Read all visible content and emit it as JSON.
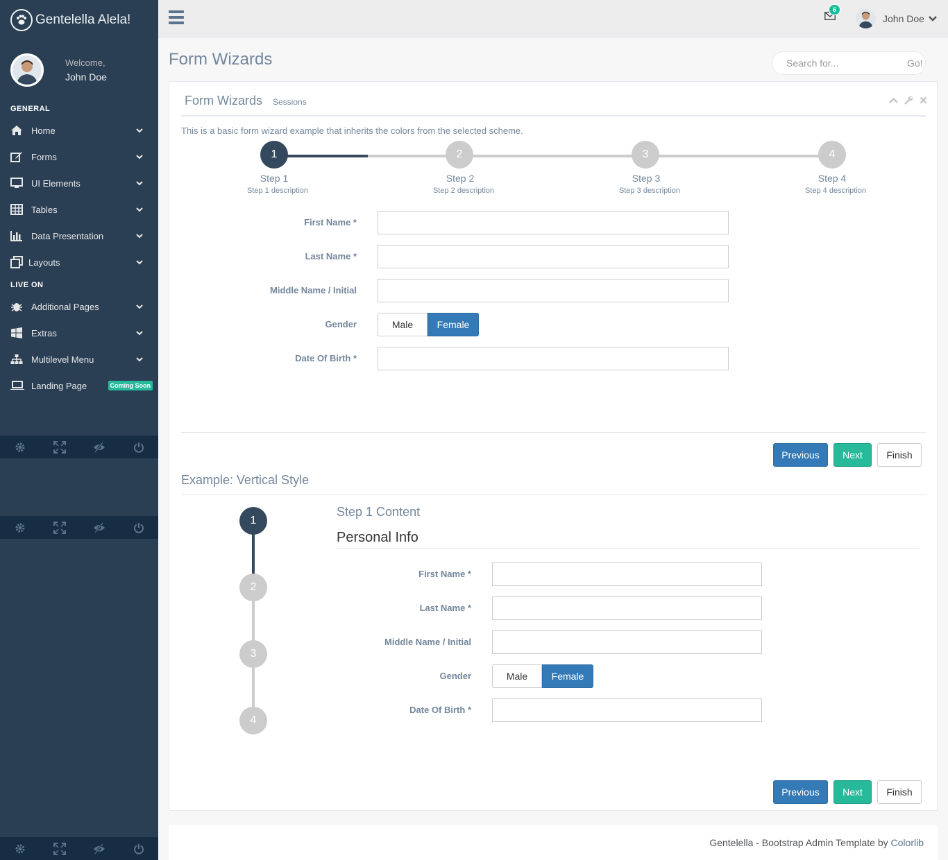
{
  "sidebar": {
    "brand": "Gentelella Alela!",
    "welcome": "Welcome,",
    "user_name": "John Doe",
    "section_general": "GENERAL",
    "section_live": "LIVE ON",
    "items": [
      {
        "label": "Home",
        "icon": "home-icon"
      },
      {
        "label": "Forms",
        "icon": "edit-icon"
      },
      {
        "label": "UI Elements",
        "icon": "desktop-icon"
      },
      {
        "label": "Tables",
        "icon": "table-icon"
      },
      {
        "label": "Data Presentation",
        "icon": "bar-chart-icon"
      },
      {
        "label": "Layouts",
        "icon": "clone-icon"
      },
      {
        "label": "Additional Pages",
        "icon": "bug-icon"
      },
      {
        "label": "Extras",
        "icon": "windows-icon"
      },
      {
        "label": "Multilevel Menu",
        "icon": "sitemap-icon"
      },
      {
        "label": "Landing Page",
        "icon": "laptop-icon",
        "badge": "Coming Soon"
      }
    ]
  },
  "topnav": {
    "mail_count": "6",
    "user_name": "John Doe"
  },
  "page": {
    "title": "Form Wizards",
    "search_placeholder": "Search for...",
    "search_button": "Go!"
  },
  "panel": {
    "title": "Form Wizards",
    "subtitle": "Sessions",
    "intro": "This is a basic form wizard example that inherits the colors from the selected scheme."
  },
  "wizard": {
    "steps": [
      {
        "num": "1",
        "title": "Step 1",
        "desc": "Step 1 description"
      },
      {
        "num": "2",
        "title": "Step 2",
        "desc": "Step 2 description"
      },
      {
        "num": "3",
        "title": "Step 3",
        "desc": "Step 3 description"
      },
      {
        "num": "4",
        "title": "Step 4",
        "desc": "Step 4 description"
      }
    ],
    "active_step": 1
  },
  "form": {
    "first_name_label": "First Name *",
    "last_name_label": "Last Name *",
    "middle_name_label": "Middle Name / Initial",
    "gender_label": "Gender",
    "male": "Male",
    "female": "Female",
    "gender_selected": "Female",
    "dob_label": "Date Of Birth *"
  },
  "buttons": {
    "previous": "Previous",
    "next": "Next",
    "finish": "Finish"
  },
  "vertical": {
    "heading": "Example: Vertical Style",
    "content_title": "Step 1 Content",
    "section_title": "Personal Info"
  },
  "footer": {
    "text": "Gentelella - Bootstrap Admin Template by ",
    "link": "Colorlib"
  },
  "colors": {
    "sidebar_bg": "#2A3F54",
    "active_step": "#34495E",
    "inactive_step": "#CCCCCC",
    "primary": "#337AB7",
    "success": "#26B99A"
  }
}
